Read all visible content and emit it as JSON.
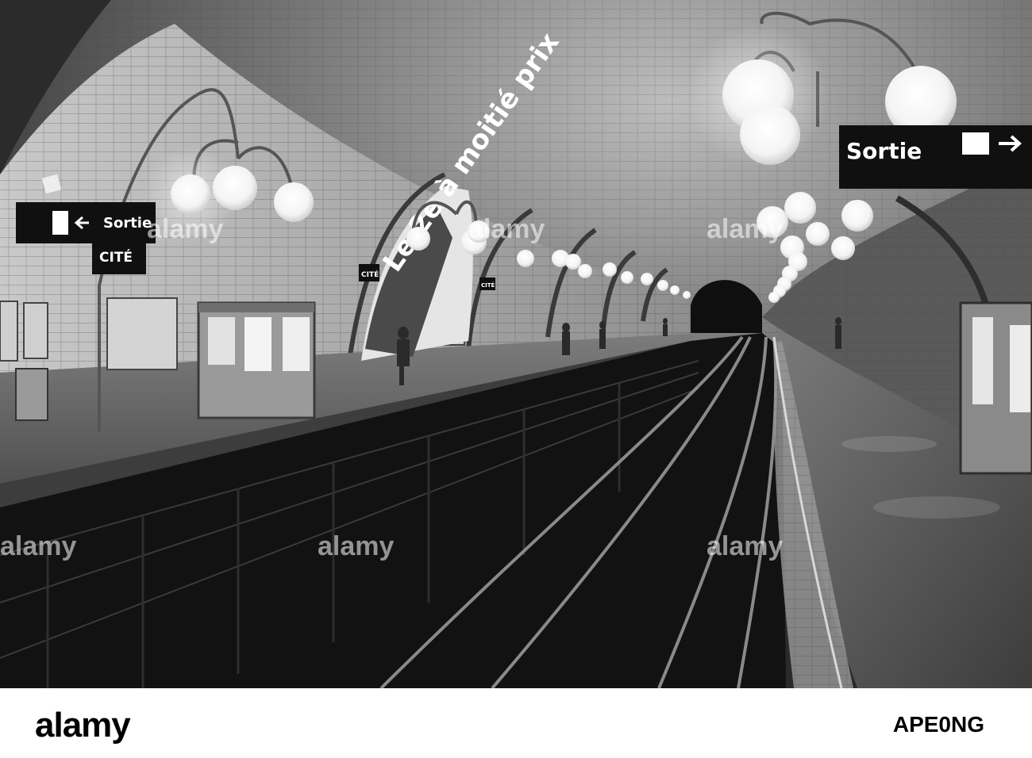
{
  "signs": {
    "sortie_main": "Sortie",
    "sortie_left": "Sortie",
    "cite_left": "CITÉ",
    "cite_mid": "CITÉ",
    "cite_far": "CITÉ",
    "poster_text": "Le 2e à moitié prix"
  },
  "watermark": {
    "text": "alamy"
  },
  "footer": {
    "logo": "alamy",
    "image_id": "APE0NG"
  }
}
